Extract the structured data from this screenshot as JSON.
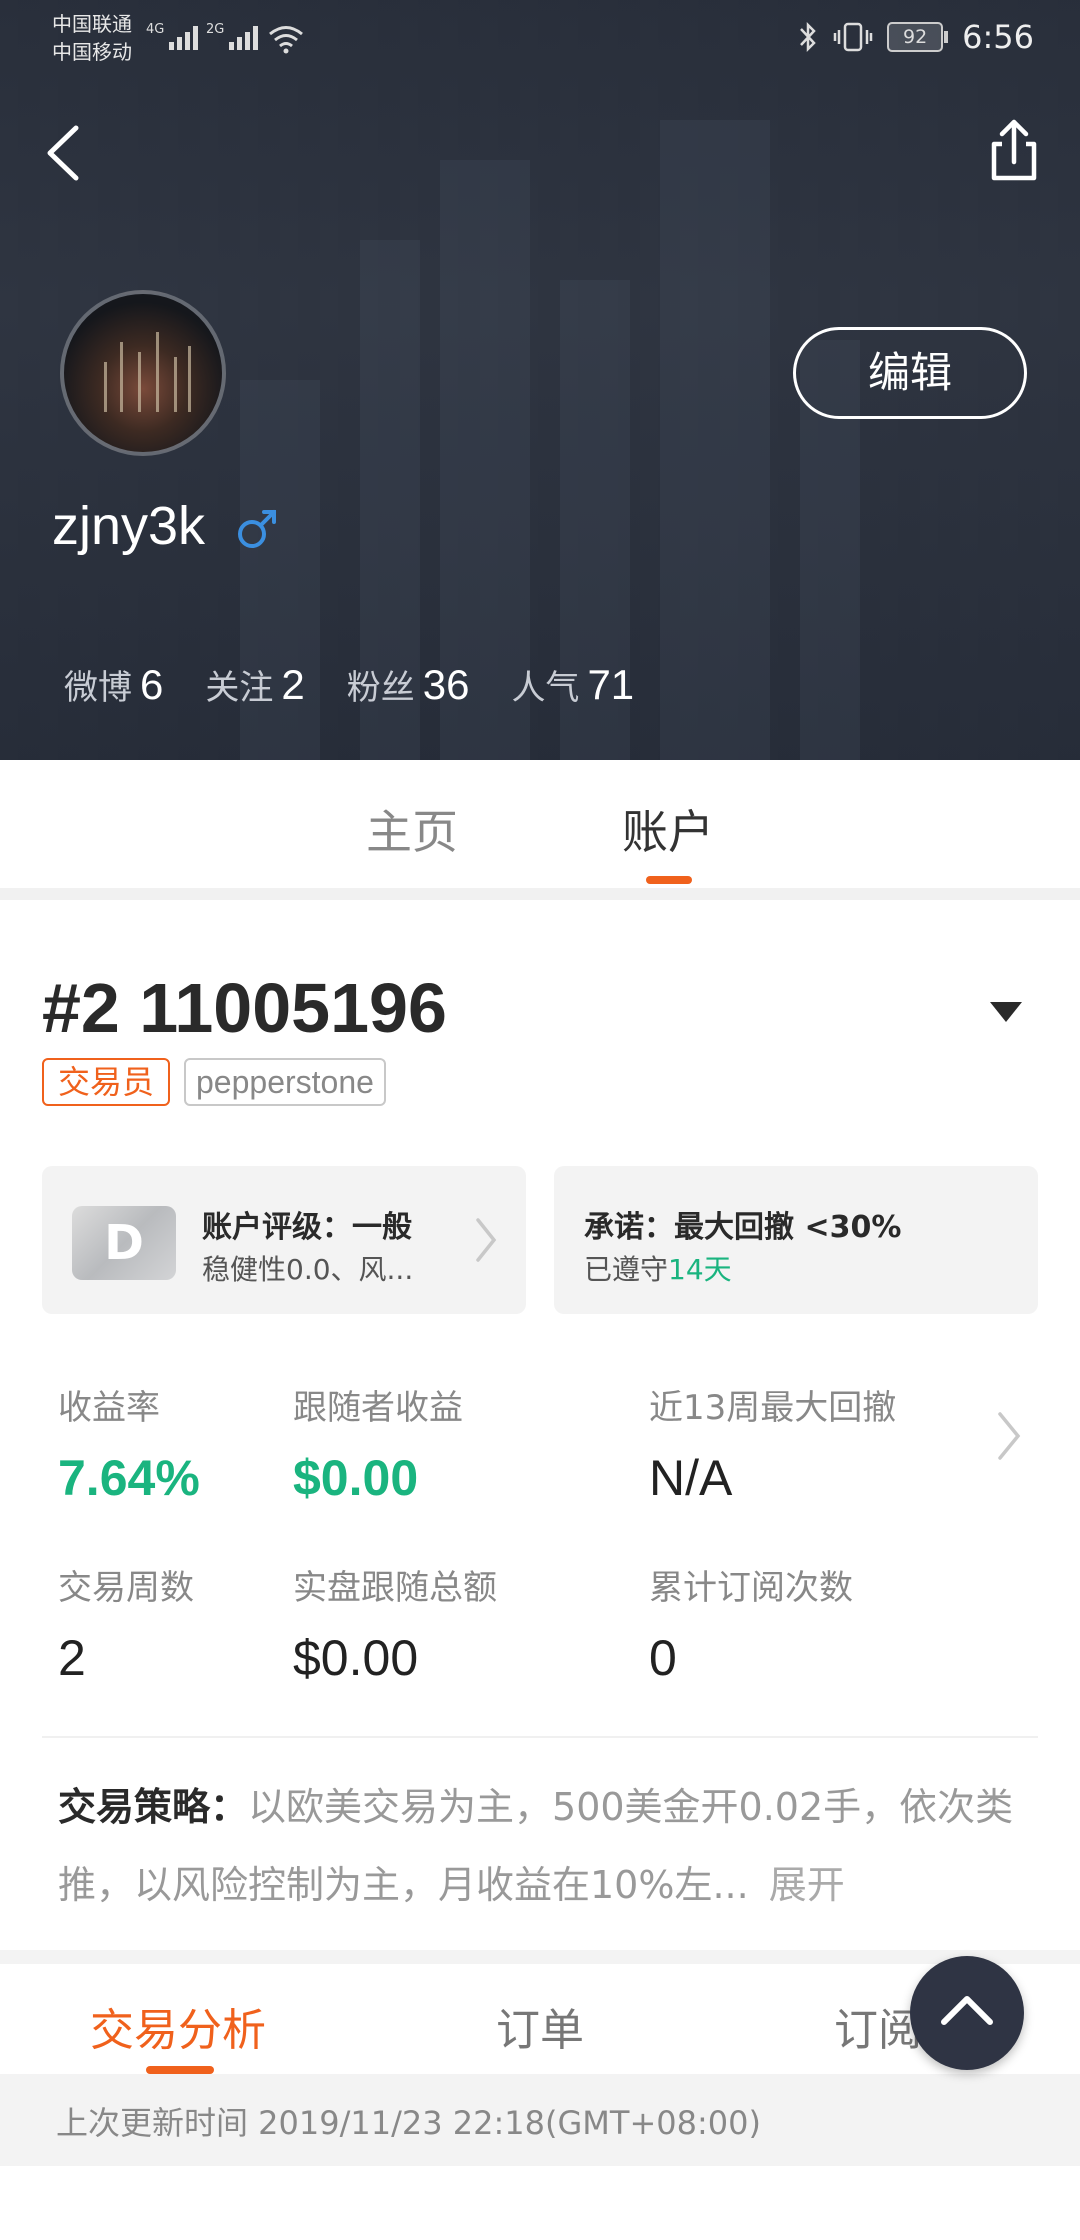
{
  "status_bar": {
    "carrier_1": "中国联通",
    "carrier_2": "中国移动",
    "net_1": "4G",
    "net_2": "2G",
    "battery": "92",
    "time": "6:56"
  },
  "profile": {
    "edit_label": "编辑",
    "username": "zjny3k",
    "gender_icon": "male-icon",
    "stats": [
      {
        "label": "微博",
        "value": "6"
      },
      {
        "label": "关注",
        "value": "2"
      },
      {
        "label": "粉丝",
        "value": "36"
      },
      {
        "label": "人气",
        "value": "71"
      }
    ]
  },
  "tabs": {
    "home": "主页",
    "account": "账户"
  },
  "account": {
    "id": "#2 11005196",
    "badge_role": "交易员",
    "badge_broker": "pepperstone",
    "rating": {
      "grade": "D",
      "title": "账户评级：一般",
      "subtitle": "稳健性0.0、风..."
    },
    "promise": {
      "title": "承诺：最大回撤 <30%",
      "kept_prefix": "已遵守",
      "kept_days": "14天"
    },
    "metrics": [
      {
        "label": "收益率",
        "value": "7.64%"
      },
      {
        "label": "跟随者收益",
        "value": "$0.00"
      },
      {
        "label": "近13周最大回撤",
        "value": "N/A"
      },
      {
        "label": "交易周数",
        "value": "2"
      },
      {
        "label": "实盘跟随总额",
        "value": "$0.00"
      },
      {
        "label": "累计订阅次数",
        "value": "0"
      }
    ],
    "strategy_label": "交易策略：",
    "strategy_text": "以欧美交易为主，500美金开0.02手，依次类推，以风险控制为主，月收益在10%左...",
    "strategy_more": "展开"
  },
  "sub_tabs": {
    "analysis": "交易分析",
    "orders": "订单",
    "subscribers": "订阅者"
  },
  "update_text": "上次更新时间 2019/11/23 22:18(GMT+08:00)",
  "colors": {
    "accent": "#f0611c",
    "positive": "#1ab47f",
    "header_bg": "#2e3440"
  }
}
